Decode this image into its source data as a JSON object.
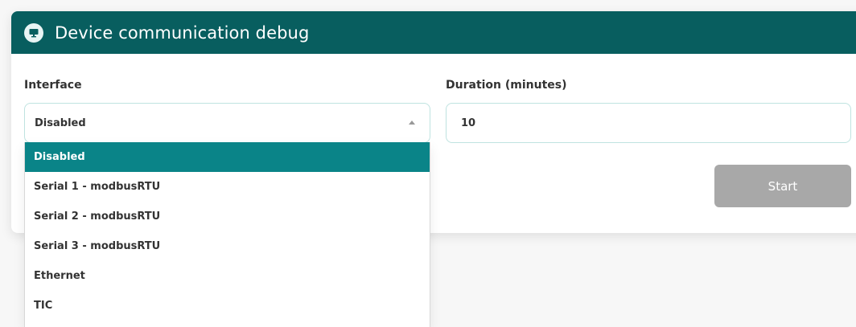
{
  "header": {
    "title": "Device communication debug",
    "icon": "monitor-icon",
    "color": "#085e5f"
  },
  "form": {
    "interface_label": "Interface",
    "interface_value": "Disabled",
    "duration_label": "Duration (minutes)",
    "duration_value": "10",
    "start_label": "Start"
  },
  "dropdown": {
    "options": [
      {
        "label": "Disabled",
        "selected": true
      },
      {
        "label": "Serial 1 - modbusRTU"
      },
      {
        "label": "Serial 2 - modbusRTU"
      },
      {
        "label": "Serial 3 - modbusRTU"
      },
      {
        "label": "Ethernet"
      },
      {
        "label": "TIC"
      }
    ],
    "selected_color": "#0a8488"
  }
}
